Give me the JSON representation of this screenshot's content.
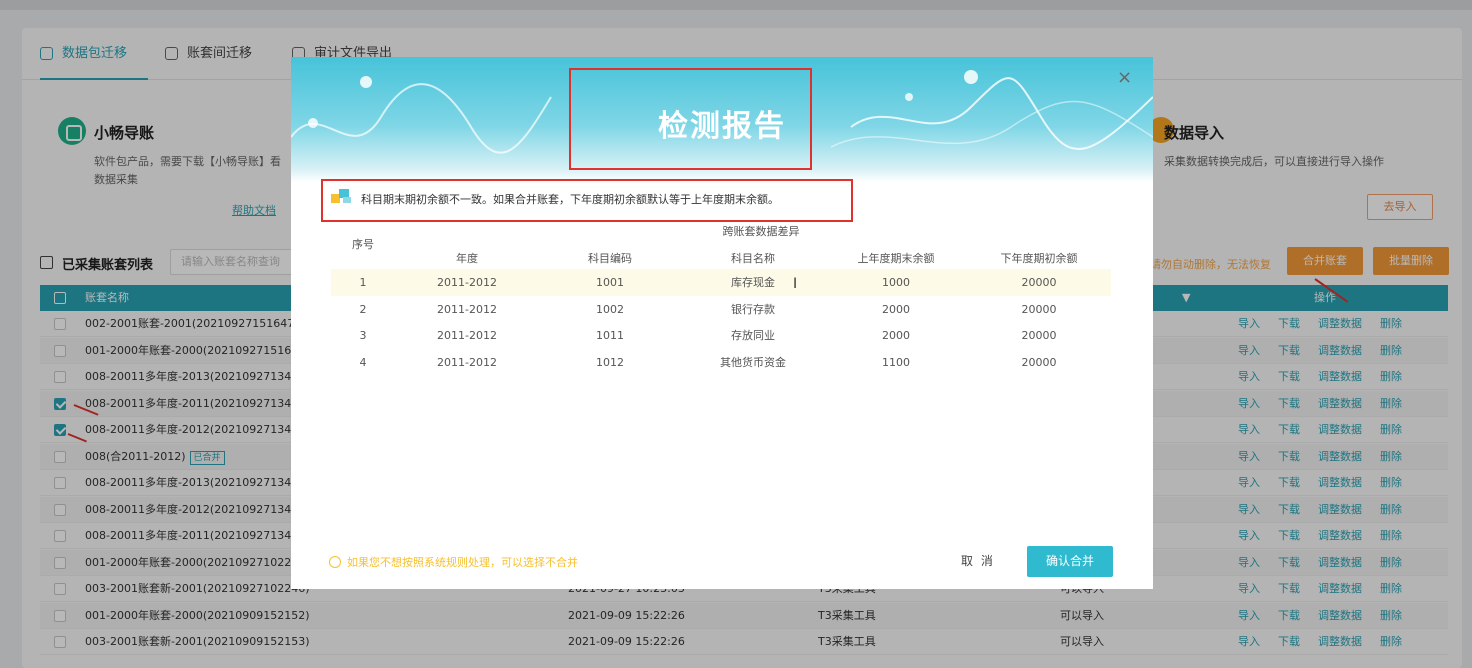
{
  "tabs": [
    {
      "label": "数据包迁移"
    },
    {
      "label": "账套间迁移"
    },
    {
      "label": "审计文件导出"
    }
  ],
  "card_left": {
    "title": "小畅导账",
    "desc_line1": "软件包产品，需要下载【小畅导账】看",
    "desc_line2": "数据采集",
    "help_link": "帮助文档"
  },
  "card_right": {
    "title": "数据导入",
    "desc": "采集数据转换完成后，可以直接进行导入操作",
    "import_button": "去导入"
  },
  "list": {
    "title": "已采集账套列表",
    "search_placeholder": "请输入账套名称查询",
    "warning": "请勿自动删除，无法恢复",
    "merge_button": "合并账套",
    "batch_delete_button": "批量删除",
    "col_name": "账套名称",
    "col_ops": "操作"
  },
  "rows": [
    {
      "name": "002-2001账套-2001(20210927151647)",
      "time": "",
      "tool": "",
      "status": "",
      "checked": false
    },
    {
      "name": "001-2000年账套-2000(20210927151646",
      "time": "",
      "tool": "",
      "status": "",
      "checked": false
    },
    {
      "name": "008-20011多年度-2013(2021092713435",
      "time": "",
      "tool": "",
      "status": "",
      "checked": false
    },
    {
      "name": "008-20011多年度-2011(2021092713435",
      "time": "",
      "tool": "",
      "status": "",
      "checked": true
    },
    {
      "name": "008-20011多年度-2012(2021092713435",
      "time": "",
      "tool": "",
      "status": "",
      "checked": true
    },
    {
      "name": "008(合2011-2012)",
      "time": "",
      "tool": "",
      "status": "",
      "checked": false,
      "tag": "已合并"
    },
    {
      "name": "008-20011多年度-2013(2021092713435",
      "time": "",
      "tool": "",
      "status": "",
      "checked": false
    },
    {
      "name": "008-20011多年度-2012(2021092713435",
      "time": "",
      "tool": "",
      "status": "",
      "checked": false
    },
    {
      "name": "008-20011多年度-2011(2021092713435",
      "time": "",
      "tool": "",
      "status": "",
      "checked": false
    },
    {
      "name": "001-2000年账套-2000(2021092710224",
      "time": "",
      "tool": "",
      "status": "",
      "checked": false
    },
    {
      "name": "003-2001账套新-2001(20210927102246)",
      "time": "2021-09-27 10:23:03",
      "tool": "T3采集工具",
      "status": "可以导入",
      "checked": false
    },
    {
      "name": "001-2000年账套-2000(20210909152152)",
      "time": "2021-09-09 15:22:26",
      "tool": "T3采集工具",
      "status": "可以导入",
      "checked": false
    },
    {
      "name": "003-2001账套新-2001(20210909152153)",
      "time": "2021-09-09 15:22:26",
      "tool": "T3采集工具",
      "status": "可以导入",
      "checked": false
    }
  ],
  "row_ops": [
    "导入",
    "下载",
    "调整数据",
    "删除"
  ],
  "modal": {
    "title": "检测报告",
    "notice": "科目期末期初余额不一致。如果合并账套，下年度期初余额默认等于上年度期末余额。",
    "group_header": "跨账套数据差异",
    "columns": [
      "序号",
      "年度",
      "科目编码",
      "科目名称",
      "上年度期末余额",
      "下年度期初余额"
    ],
    "rows": [
      [
        "1",
        "2011-2012",
        "1001",
        "库存现金",
        "1000",
        "20000"
      ],
      [
        "2",
        "2011-2012",
        "1002",
        "银行存款",
        "2000",
        "20000"
      ],
      [
        "3",
        "2011-2012",
        "1011",
        "存放同业",
        "2000",
        "20000"
      ],
      [
        "4",
        "2011-2012",
        "1012",
        "其他货币资金",
        "1100",
        "20000"
      ]
    ],
    "hint": "如果您不想按照系统规则处理，可以选择不合并",
    "cancel": "取 消",
    "confirm": "确认合并",
    "close": "×"
  },
  "colors": {
    "accent": "#2aa3b5",
    "header_gradient_top": "#47c3d9",
    "confirm": "#2fbad0",
    "warning": "#f6c030",
    "annotation_red": "#e0322d",
    "orange": "#f49a38"
  }
}
